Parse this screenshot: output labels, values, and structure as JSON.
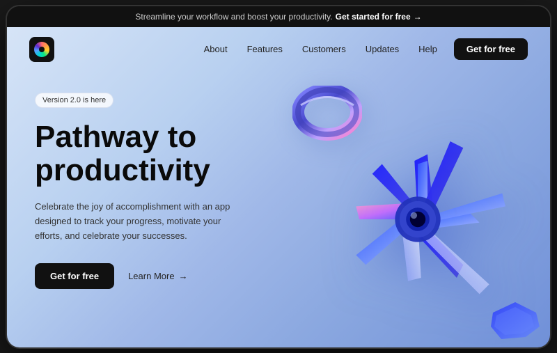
{
  "announcement": {
    "text": "Streamline your workflow and boost your productivity.",
    "cta": "Get started for free",
    "arrow": "→"
  },
  "navbar": {
    "logo_alt": "App logo",
    "links": [
      {
        "label": "About",
        "id": "about"
      },
      {
        "label": "Features",
        "id": "features"
      },
      {
        "label": "Customers",
        "id": "customers"
      },
      {
        "label": "Updates",
        "id": "updates"
      },
      {
        "label": "Help",
        "id": "help"
      }
    ],
    "cta": "Get for free"
  },
  "hero": {
    "badge": "Version 2.0 is here",
    "title_line1": "Pathway to",
    "title_line2": "productivity",
    "subtitle": "Celebrate the joy of accomplishment with an app designed to track your progress, motivate your efforts, and celebrate your successes.",
    "btn_primary": "Get for free",
    "btn_secondary": "Learn More",
    "btn_arrow": "→"
  },
  "colors": {
    "bg_gradient_start": "#d6e4f7",
    "bg_gradient_end": "#7090d8",
    "accent_blue": "#3355ff",
    "dark": "#111111"
  }
}
